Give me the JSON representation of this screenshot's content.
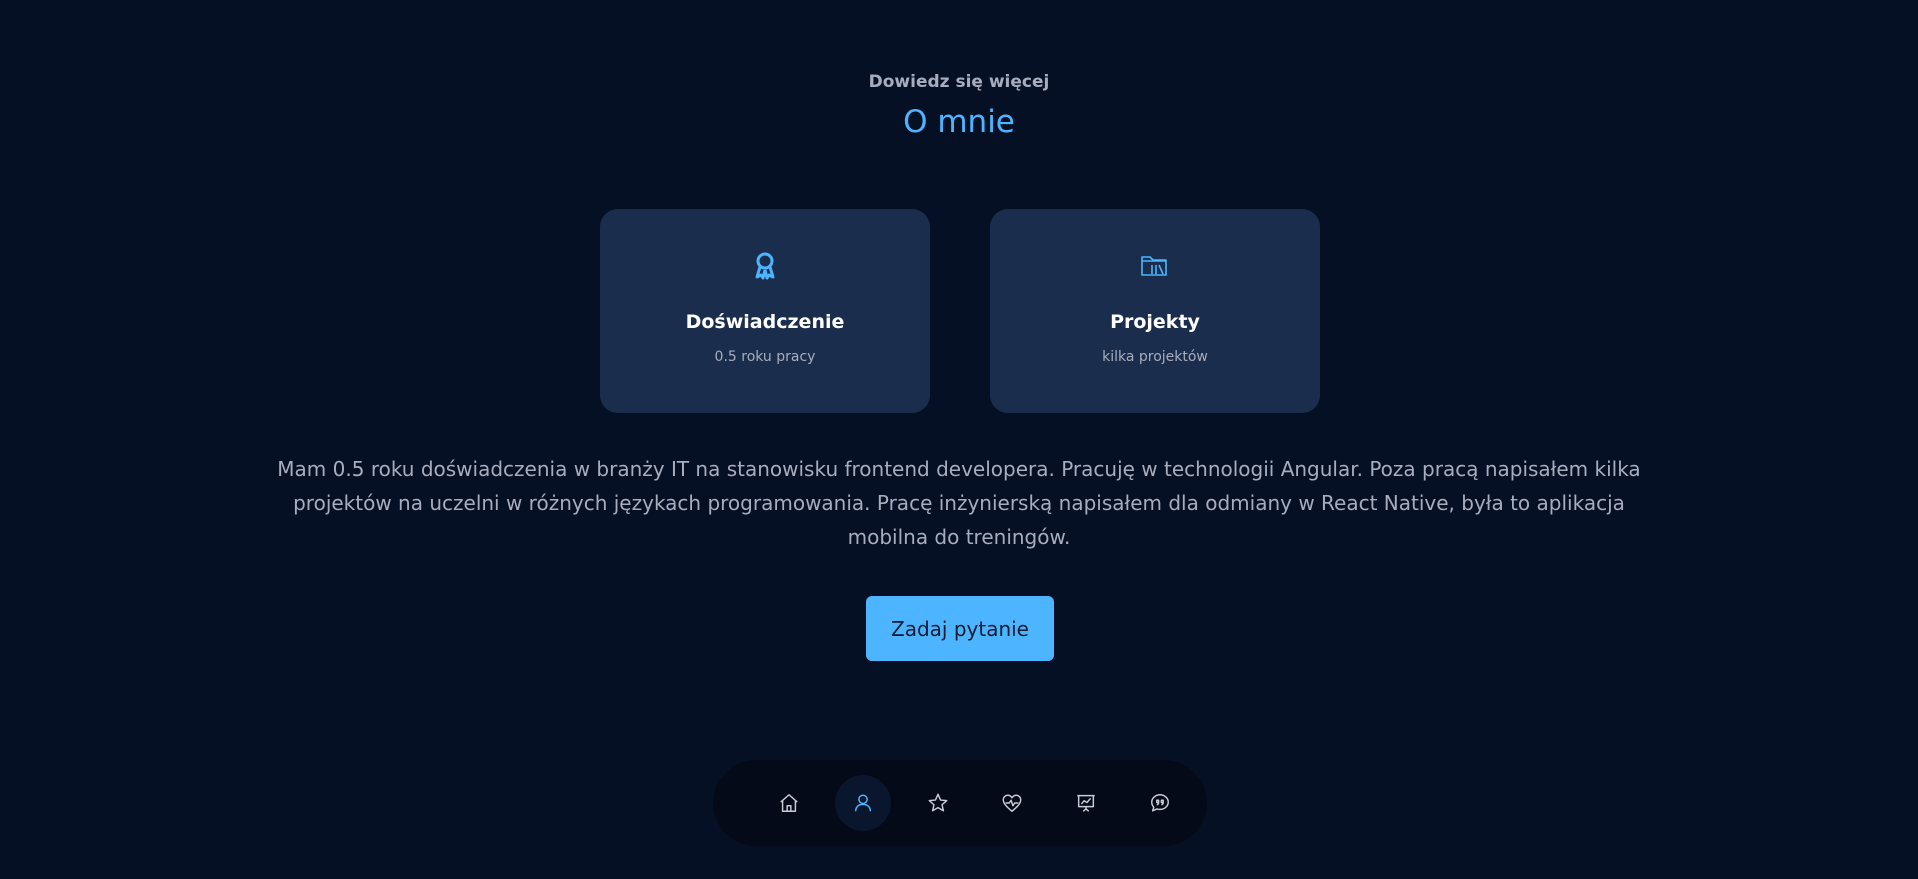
{
  "header": {
    "subtitle": "Dowiedz się więcej",
    "title": "O mnie"
  },
  "cards": [
    {
      "icon": "award-icon",
      "title": "Doświadczenie",
      "subtitle": "0.5 roku pracy"
    },
    {
      "icon": "folder-icon",
      "title": "Projekty",
      "subtitle": "kilka projektów"
    }
  ],
  "about": {
    "text": "Mam 0.5 roku doświadczenia w branży IT na stanowisku frontend developera. Pracuję w technologii Angular. Poza pracą napisałem kilka projektów na uczelni w różnych językach programowania. Pracę inżynierską napisałem dla odmiany w React Native, była to aplikacja mobilna do treningów."
  },
  "cta": {
    "label": "Zadaj pytanie"
  },
  "nav": {
    "items": [
      {
        "icon": "home-icon",
        "active": false
      },
      {
        "icon": "user-icon",
        "active": true
      },
      {
        "icon": "star-icon",
        "active": false
      },
      {
        "icon": "heart-pulse-icon",
        "active": false
      },
      {
        "icon": "presentation-icon",
        "active": false
      },
      {
        "icon": "chat-quote-icon",
        "active": false
      }
    ]
  },
  "colors": {
    "background": "#061025",
    "accent": "#4db5ff",
    "card": "#1b2d4d",
    "muted_text": "#a7adbd",
    "nav_background": "#040a18",
    "nav_icon": "#c9ccd4"
  }
}
